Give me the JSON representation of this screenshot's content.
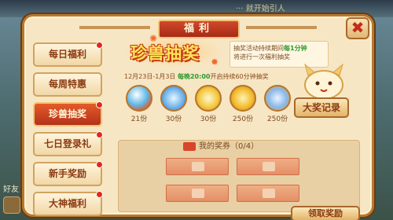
{
  "background": {
    "top_text": "··· 就开始引人",
    "left_text": "好友"
  },
  "window": {
    "title": "福利",
    "close_symbol": "✖"
  },
  "menu": {
    "items": [
      {
        "label": "每日福利",
        "red_dot": true,
        "active": false
      },
      {
        "label": "每周特惠",
        "red_dot": false,
        "active": false
      },
      {
        "label": "珍兽抽奖",
        "red_dot": true,
        "active": true
      },
      {
        "label": "七日登录礼",
        "red_dot": true,
        "active": false
      },
      {
        "label": "新手奖励",
        "red_dot": true,
        "active": false
      },
      {
        "label": "大神福利",
        "red_dot": true,
        "active": false
      }
    ]
  },
  "event": {
    "title": "珍兽抽奖",
    "notice_prefix": "抽奖活动持续期间",
    "notice_highlight": "每1分钟",
    "notice_suffix": "将进行一次福利抽奖",
    "date_prefix": "12月23日-1月3日",
    "date_highlight": "每晚20:00",
    "date_suffix": "开启持续60分钟抽奖"
  },
  "rewards": [
    {
      "icon": "jade-orb-icon",
      "count": "21份"
    },
    {
      "icon": "blue-scroll-icon",
      "count": "30份"
    },
    {
      "icon": "gold-scroll-icon",
      "count": "30份"
    },
    {
      "icon": "gold-pouch-icon",
      "count": "250份"
    },
    {
      "icon": "card-pouch-icon",
      "count": "250份"
    }
  ],
  "buttons": {
    "big_prize_record": "大奖记录",
    "bottom": "领取奖励"
  },
  "tickets": {
    "header": "我的奖券（0/4）"
  },
  "colors": {
    "accent_red": "#b3321a",
    "highlight_green": "#2c9a2c",
    "title_yellow": "#ffe45a"
  }
}
